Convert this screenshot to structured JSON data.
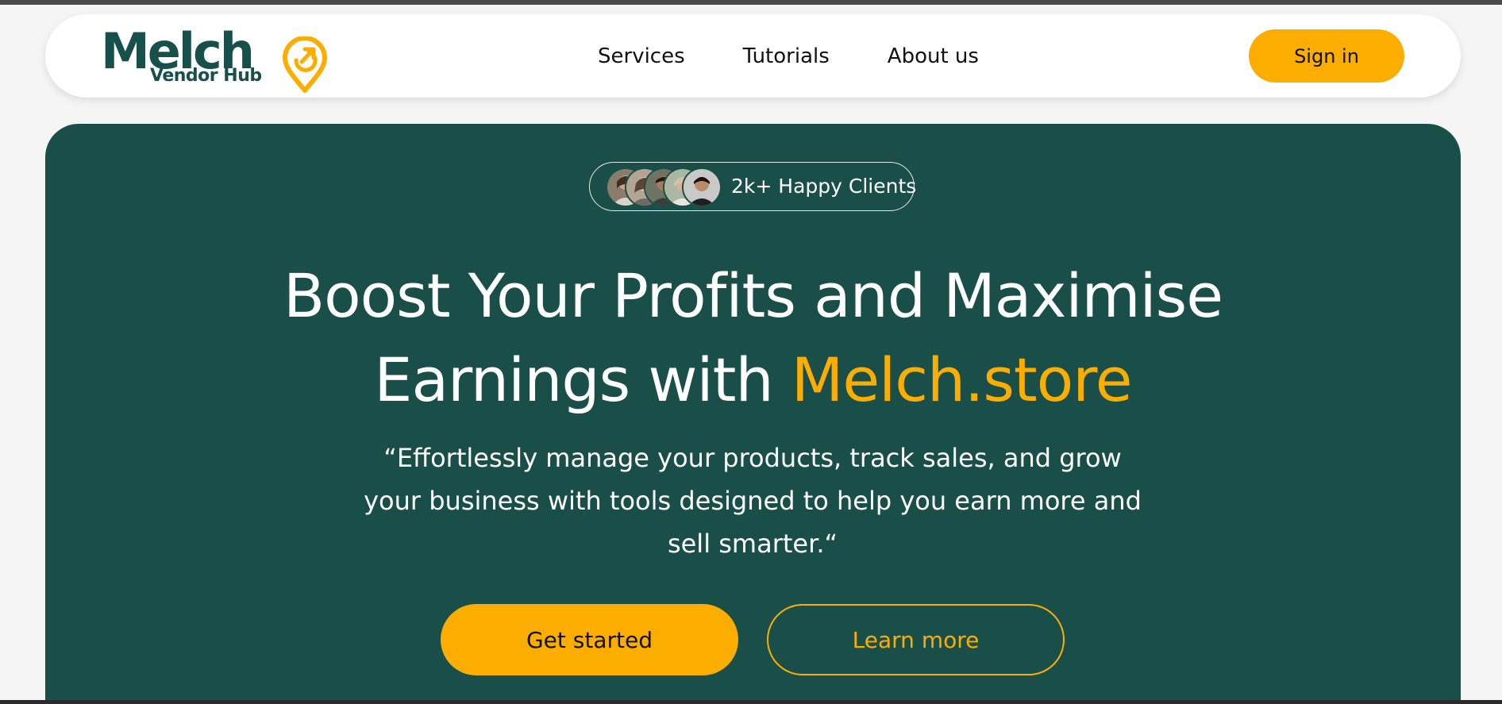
{
  "brand": {
    "name": "Melch",
    "subtitle": "Vendor Hub",
    "logo_icon": "location-pin-arrow-icon",
    "primary_color": "#17504a",
    "accent_color": "#fbae00"
  },
  "nav": {
    "links": [
      "Services",
      "Tutorials",
      "About us"
    ],
    "signin_label": "Sign in"
  },
  "hero": {
    "background_color": "#194f48",
    "badge": {
      "text": "2k+ Happy Clients",
      "avatars": [
        "client-avatar-1",
        "client-avatar-2",
        "client-avatar-3",
        "client-avatar-4",
        "client-avatar-5"
      ]
    },
    "headline": {
      "line1": "Boost Your Profits and Maximise",
      "line2_prefix": "Earnings with ",
      "line2_accent": "Melch.store"
    },
    "subtext": "“Effortlessly manage your products, track sales, and grow your business with tools designed to help you earn more and sell smarter.“",
    "primary_cta": "Get started",
    "secondary_cta": "Learn more"
  }
}
